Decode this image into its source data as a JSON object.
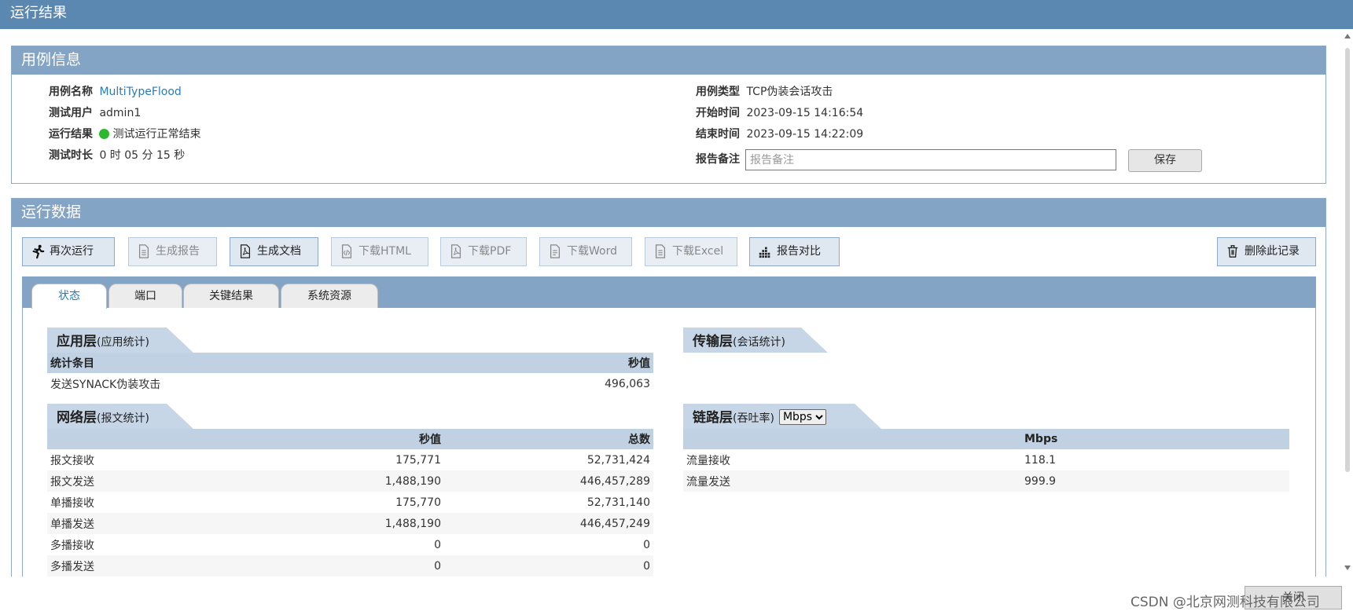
{
  "window": {
    "title": "运行结果"
  },
  "case_info": {
    "heading": "用例信息",
    "name_label": "用例名称",
    "name_value": "MultiTypeFlood",
    "user_label": "测试用户",
    "user_value": "admin1",
    "result_label": "运行结果",
    "result_value": "测试运行正常结束",
    "duration_label": "测试时长",
    "duration_value": "0 时 05 分 15 秒",
    "type_label": "用例类型",
    "type_value": "TCP伪装会话攻击",
    "start_label": "开始时间",
    "start_value": "2023-09-15 14:16:54",
    "end_label": "结束时间",
    "end_value": "2023-09-15 14:22:09",
    "remark_label": "报告备注",
    "remark_placeholder": "报告备注",
    "save_label": "保存",
    "status_color": "#2eb82e"
  },
  "run_data": {
    "heading": "运行数据",
    "toolbar": {
      "rerun": "再次运行",
      "gen_report": "生成报告",
      "gen_doc": "生成文档",
      "dl_html": "下载HTML",
      "dl_pdf": "下载PDF",
      "dl_word": "下载Word",
      "dl_excel": "下载Excel",
      "compare": "报告对比",
      "delete": "删除此记录"
    },
    "tabs": [
      "状态",
      "端口",
      "关键结果",
      "系统资源"
    ],
    "active_tab": "状态"
  },
  "app_layer": {
    "title": "应用层",
    "subtitle": "(应用统计)",
    "headers": [
      "统计条目",
      "秒值"
    ],
    "rows": [
      [
        "发送SYNACK伪装攻击",
        "496,063"
      ]
    ]
  },
  "transport_layer": {
    "title": "传输层",
    "subtitle": "(会话统计)"
  },
  "network_layer": {
    "title": "网络层",
    "subtitle": "(报文统计)",
    "headers": [
      "",
      "秒值",
      "总数"
    ],
    "rows": [
      [
        "报文接收",
        "175,771",
        "52,731,424"
      ],
      [
        "报文发送",
        "1,488,190",
        "446,457,289"
      ],
      [
        "单播接收",
        "175,770",
        "52,731,140"
      ],
      [
        "单播发送",
        "1,488,190",
        "446,457,249"
      ],
      [
        "多播接收",
        "0",
        "0"
      ],
      [
        "多播发送",
        "0",
        "0"
      ]
    ]
  },
  "link_layer": {
    "title": "链路层",
    "subtitle": "(吞吐率)",
    "unit_selected": "Mbps",
    "headers": [
      "",
      "Mbps"
    ],
    "rows": [
      [
        "流量接收",
        "118.1"
      ],
      [
        "流量发送",
        "999.9"
      ]
    ]
  },
  "footer": {
    "close_label": "关闭",
    "watermark": "CSDN @北京网测科技有限公司"
  }
}
